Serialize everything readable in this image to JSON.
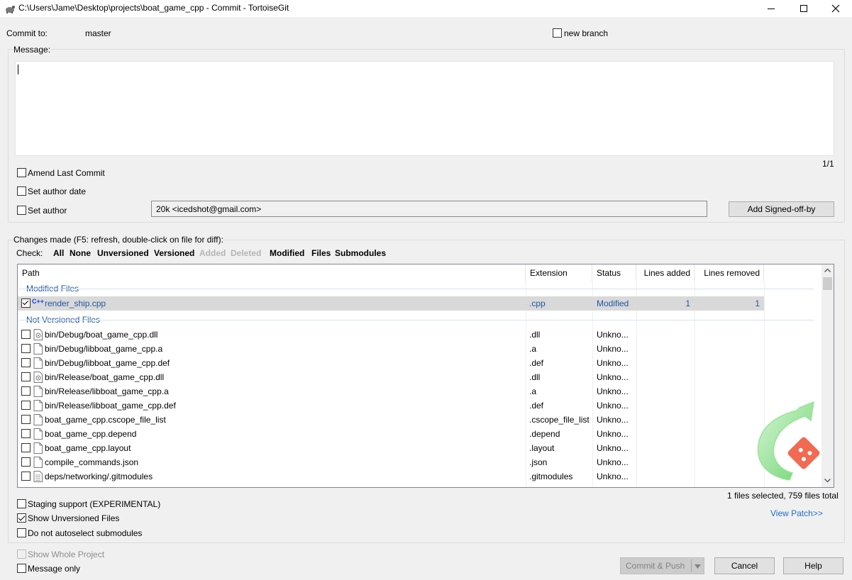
{
  "window": {
    "title": "C:\\Users\\Jame\\Desktop\\projects\\boat_game_cpp - Commit - TortoiseGit",
    "minimize": "—",
    "maximize": "☐",
    "close": "✕"
  },
  "commit_to": {
    "label": "Commit to:",
    "branch": "master",
    "new_branch_label": "new branch"
  },
  "message": {
    "label": "Message:",
    "value": "",
    "counter": "1/1"
  },
  "options": {
    "amend": "Amend Last Commit",
    "author_date": "Set author date",
    "set_author": "Set author",
    "author_value": "20k <icedshot@gmail.com>",
    "signed_off": "Add Signed-off-by"
  },
  "changes": {
    "label": "Changes made (F5: refresh, double-click on file for diff):",
    "check_label": "Check:",
    "filters": [
      {
        "label": "All",
        "enabled": true
      },
      {
        "label": "None",
        "enabled": true
      },
      {
        "label": "Unversioned",
        "enabled": true
      },
      {
        "label": "Versioned",
        "enabled": true
      },
      {
        "label": "Added",
        "enabled": false
      },
      {
        "label": "Deleted",
        "enabled": false
      },
      {
        "label": "Modified",
        "enabled": true
      },
      {
        "label": "Files",
        "enabled": true
      },
      {
        "label": "Submodules",
        "enabled": true
      }
    ]
  },
  "table": {
    "columns": [
      "Path",
      "Extension",
      "Status",
      "Lines added",
      "Lines removed"
    ],
    "modified_group": "Modified Files",
    "modified_rows": [
      {
        "path": "render_ship.cpp",
        "ext": ".cpp",
        "status": "Modified",
        "added": "1",
        "removed": "1"
      }
    ],
    "unversioned_group": "Not Versioned Files",
    "unversioned_rows": [
      {
        "path": "bin/Debug/boat_game_cpp.dll",
        "ext": ".dll",
        "status": "Unkno...",
        "icon": "dll-file-icon"
      },
      {
        "path": "bin/Debug/libboat_game_cpp.a",
        "ext": ".a",
        "status": "Unkno...",
        "icon": "file-icon"
      },
      {
        "path": "bin/Debug/libboat_game_cpp.def",
        "ext": ".def",
        "status": "Unkno...",
        "icon": "file-icon"
      },
      {
        "path": "bin/Release/boat_game_cpp.dll",
        "ext": ".dll",
        "status": "Unkno...",
        "icon": "dll-file-icon"
      },
      {
        "path": "bin/Release/libboat_game_cpp.a",
        "ext": ".a",
        "status": "Unkno...",
        "icon": "file-icon"
      },
      {
        "path": "bin/Release/libboat_game_cpp.def",
        "ext": ".def",
        "status": "Unkno...",
        "icon": "file-icon"
      },
      {
        "path": "boat_game_cpp.cscope_file_list",
        "ext": ".cscope_file_list",
        "status": "Unkno...",
        "icon": "file-icon"
      },
      {
        "path": "boat_game_cpp.depend",
        "ext": ".depend",
        "status": "Unkno...",
        "icon": "file-icon"
      },
      {
        "path": "boat_game_cpp.layout",
        "ext": ".layout",
        "status": "Unkno...",
        "icon": "file-icon"
      },
      {
        "path": "compile_commands.json",
        "ext": ".json",
        "status": "Unkno...",
        "icon": "file-icon"
      },
      {
        "path": "deps/networking/.gitmodules",
        "ext": ".gitmodules",
        "status": "Unkno...",
        "icon": "text-file-icon"
      }
    ]
  },
  "bottom": {
    "staging": "Staging support (EXPERIMENTAL)",
    "show_unversioned": "Show Unversioned Files",
    "no_autoselect": "Do not autoselect submodules",
    "selection_info": "1 files selected, 759 files total",
    "view_patch": "View Patch>>",
    "show_whole_project": "Show Whole Project",
    "message_only": "Message only",
    "commit_push": "Commit & Push",
    "cancel": "Cancel",
    "help": "Help"
  },
  "colors": {
    "accent": "#1e56a0",
    "selected_row": "#d9d9d9",
    "logo_green": "#6cd46c",
    "logo_red": "#f05033"
  }
}
